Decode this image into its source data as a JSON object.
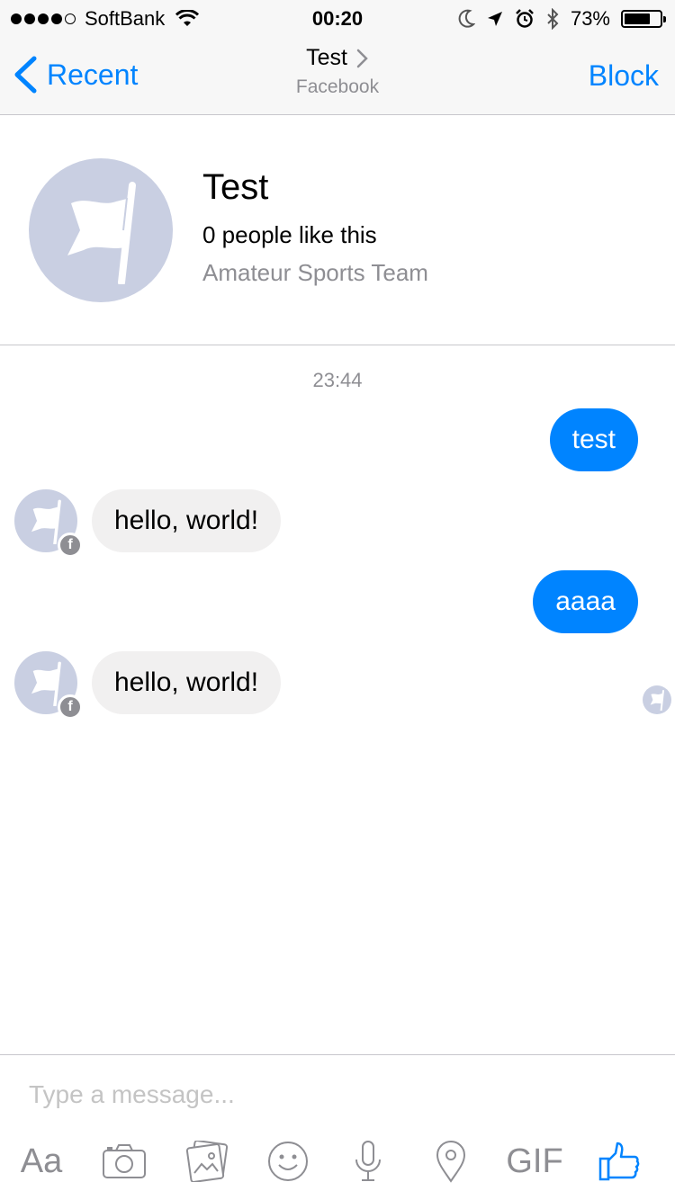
{
  "status_bar": {
    "carrier": "SoftBank",
    "time": "00:20",
    "battery": "73%",
    "battery_level": 0.73
  },
  "nav": {
    "back_label": "Recent",
    "title": "Test",
    "subtitle": "Facebook",
    "block_label": "Block"
  },
  "profile": {
    "name": "Test",
    "likes": "0 people like this",
    "category": "Amateur Sports Team"
  },
  "conversation": {
    "timestamp": "23:44",
    "messages": [
      {
        "direction": "out",
        "text": "test"
      },
      {
        "direction": "in",
        "text": "hello, world!"
      },
      {
        "direction": "out",
        "text": "aaaa"
      },
      {
        "direction": "in",
        "text": "hello, world!"
      }
    ]
  },
  "composer": {
    "placeholder": "Type a message...",
    "text_button": "Aa",
    "gif_button": "GIF",
    "icons": [
      "camera-icon",
      "photos-icon",
      "emoji-icon",
      "microphone-icon",
      "location-icon",
      "thumbs-up-icon"
    ]
  },
  "colors": {
    "accent": "#0084ff",
    "incoming_bubble": "#f1f0f0",
    "avatar_bg": "#c9cfe2",
    "muted": "#8e8e93"
  }
}
